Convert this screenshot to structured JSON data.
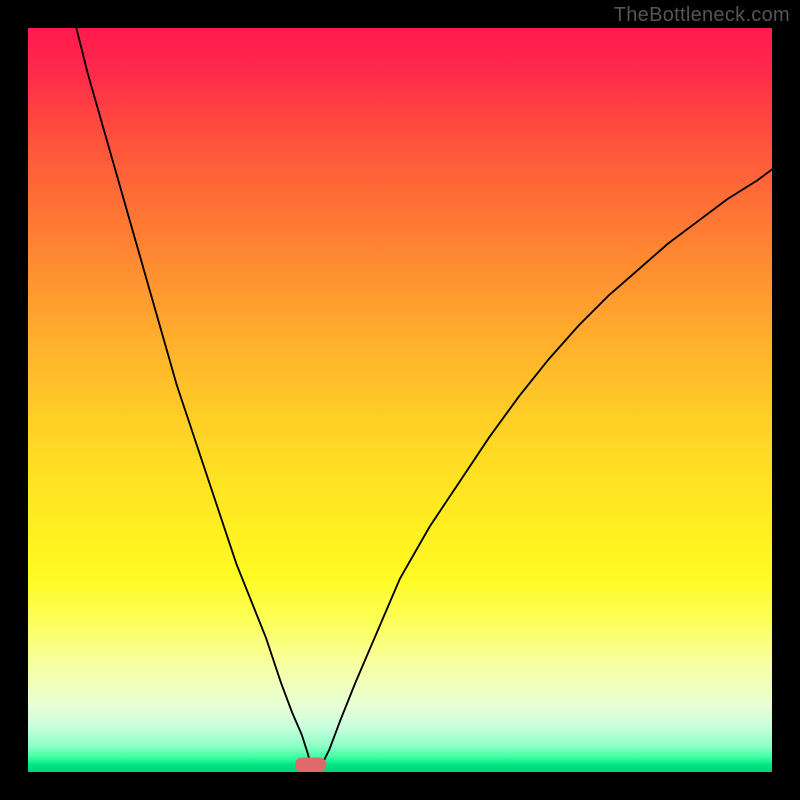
{
  "watermark": "TheBottleneck.com",
  "chart_data": {
    "type": "line",
    "title": "",
    "xlabel": "",
    "ylabel": "",
    "xlim": [
      0,
      100
    ],
    "ylim": [
      0,
      100
    ],
    "grid": false,
    "legend": false,
    "background": {
      "gradient_direction": "vertical",
      "top_color": "#ff1a4f",
      "mid_color": "#ffe123",
      "bottom_color": "#00d077",
      "meaning": "red = bottleneck, green = balanced"
    },
    "marker": {
      "shape": "pill",
      "x": 38,
      "y": 1,
      "color": "#e06a6a"
    },
    "series": [
      {
        "name": "left-branch",
        "x": [
          6.5,
          8,
          10,
          12,
          14,
          16,
          18,
          20,
          22,
          24,
          26,
          28,
          30,
          32,
          34,
          35.5,
          36.8,
          37.6,
          38
        ],
        "y": [
          100,
          94,
          87,
          80,
          73,
          66,
          59,
          52,
          46,
          40,
          34,
          28,
          23,
          18,
          12,
          8,
          5,
          2.5,
          1
        ]
      },
      {
        "name": "right-branch",
        "x": [
          39.5,
          40.5,
          42,
          44,
          47,
          50,
          54,
          58,
          62,
          66,
          70,
          74,
          78,
          82,
          86,
          90,
          94,
          98,
          100
        ],
        "y": [
          1,
          3,
          7,
          12,
          19,
          26,
          33,
          39,
          45,
          50.5,
          55.5,
          60,
          64,
          67.5,
          71,
          74,
          77,
          79.5,
          81
        ]
      }
    ]
  }
}
